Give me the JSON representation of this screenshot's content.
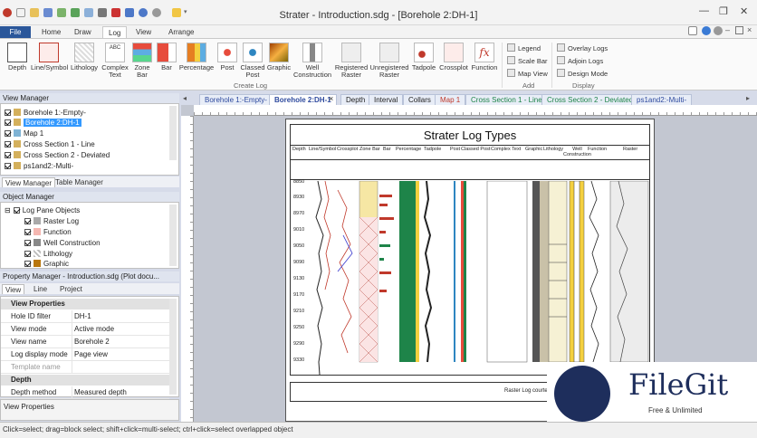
{
  "window": {
    "title": "Strater - Introduction.sdg - [Borehole 2:DH-1]",
    "minimize_glyph": "—",
    "restore_glyph": "❐",
    "close_glyph": "✕"
  },
  "ribbon_tabs": [
    "File",
    "Home",
    "Draw",
    "Log",
    "View",
    "Arrange"
  ],
  "ribbon": {
    "create_log_buttons": [
      "Depth",
      "Line/Symbol",
      "Lithology",
      "Complex\nText",
      "Zone\nBar",
      "Bar",
      "Percentage",
      "Post",
      "Classed\nPost",
      "Graphic",
      "Well\nConstruction",
      "Registered\nRaster",
      "Unregistered\nRaster",
      "Tadpole",
      "Crossplot",
      "Function"
    ],
    "create_log_label": "Create Log",
    "add_items": [
      "Legend",
      "Scale Bar",
      "Map View"
    ],
    "add_label": "Add",
    "display_items": [
      "Overlay Logs",
      "Adjoin Logs",
      "Design Mode"
    ],
    "display_label": "Display"
  },
  "view_manager": {
    "title": "View Manager",
    "items": [
      "Borehole 1:-Empty-",
      "Borehole 2:DH-1",
      "Map 1",
      "Cross Section 1 - Line",
      "Cross Section 2 - Deviated",
      "ps1and2:-Multi-"
    ],
    "tabs": [
      "View Manager",
      "Table Manager"
    ]
  },
  "object_manager": {
    "title": "Object Manager",
    "items": [
      "Log Pane Objects",
      "Raster Log",
      "Function",
      "Well Construction",
      "Lithology",
      "Graphic"
    ]
  },
  "property_manager": {
    "title": "Property Manager - Introduction.sdg (Plot docu...",
    "tabs": [
      "View",
      "Line",
      "Project"
    ],
    "sections": {
      "view_properties": "View Properties",
      "depth": "Depth"
    },
    "rows": [
      {
        "k": "Hole ID filter",
        "v": "DH-1"
      },
      {
        "k": "View mode",
        "v": "Active mode"
      },
      {
        "k": "View name",
        "v": "Borehole 2"
      },
      {
        "k": "Log display mode",
        "v": "Page view"
      },
      {
        "k": "Template name",
        "v": ""
      }
    ],
    "depth_rows": [
      {
        "k": "Depth method",
        "v": "Measured depth"
      }
    ],
    "footer": "View Properties"
  },
  "doc_tabs": [
    "Borehole 1:-Empty-",
    "Borehole 2:DH-1",
    "Depth",
    "Interval",
    "Collars",
    "Map 1",
    "Cross Section 1 - Line",
    "Cross Section 2 - Deviated",
    "ps1and2:-Multi-"
  ],
  "log": {
    "title": "Strater Log Types",
    "columns": [
      "Depth",
      "Line/Symbol",
      "Crossplot",
      "Zone Bar",
      "Bar",
      "Percentage",
      "Tadpole",
      "Post",
      "Classed Post",
      "Complex Text",
      "Graphic",
      "Lithology",
      "Well\nConstruction",
      "Function",
      "Raster"
    ],
    "depths": [
      "8850",
      "8930",
      "8970",
      "9010",
      "9050",
      "9090",
      "9130",
      "9170",
      "9210",
      "9250",
      "9290",
      "9330"
    ],
    "footer_text": "Raster Log courtesy"
  },
  "status": "Click=select; drag=block select; shift+click=multi-select; ctrl+click=select overlapped object",
  "watermark": {
    "title": "FileGit",
    "subtitle": "Free & Unlimited"
  },
  "colors": {
    "file_tab": "#2b579a",
    "panel_header": "#dfe4ef",
    "selected": "#3399ff",
    "brand": "#1e2e5c"
  }
}
